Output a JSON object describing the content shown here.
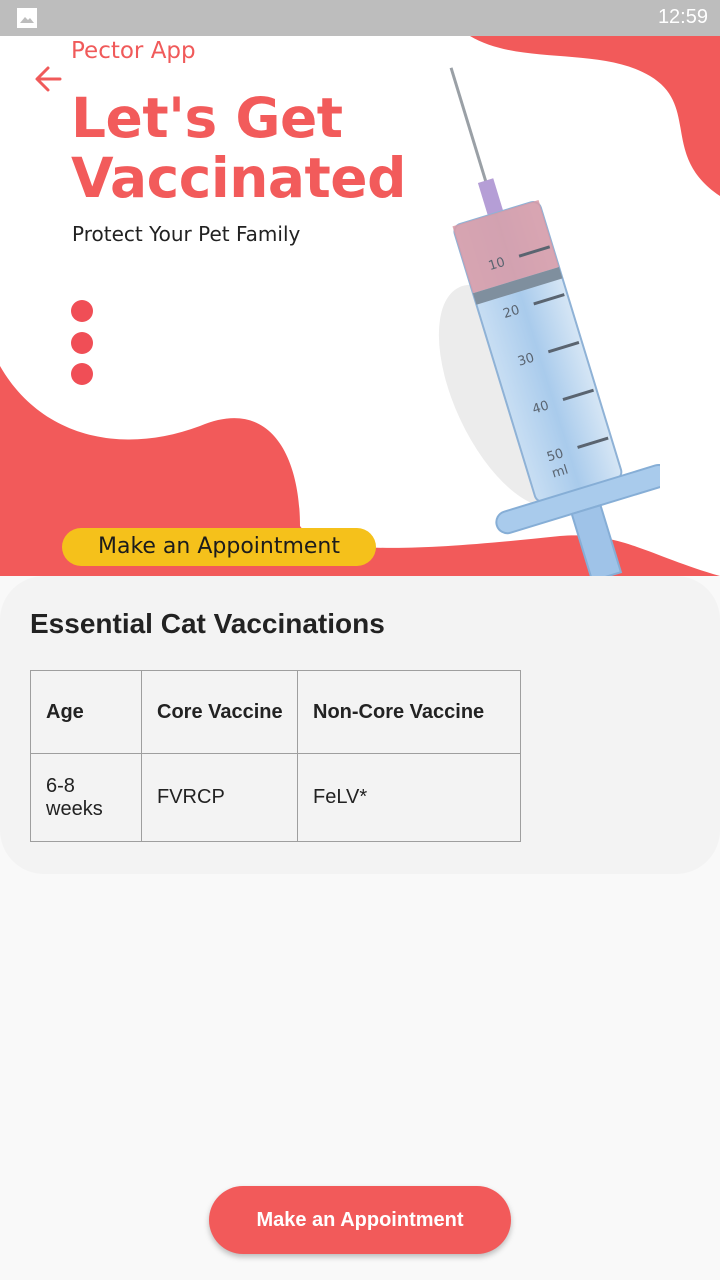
{
  "status_bar": {
    "time": "12:59"
  },
  "hero": {
    "brand": "Pector App",
    "headline_line1": "Let's Get",
    "headline_line2": "Vaccinated",
    "tagline": "Protect Your Pet Family",
    "pill_label": "Make an Appointment",
    "syringe_marks": [
      "10",
      "20",
      "30",
      "40",
      "50",
      "ml"
    ]
  },
  "card": {
    "title": "Essential Cat Vaccinations",
    "table": {
      "headers": [
        "Age",
        "Core Vaccine",
        "Non-Core Vaccine"
      ],
      "rows": [
        {
          "age_line1": "6-8",
          "age_line2": "weeks",
          "core": "FVRCP",
          "noncore": "FeLV*"
        }
      ]
    }
  },
  "cta": {
    "label": "Make an Appointment"
  },
  "colors": {
    "accent": "#f25a5a",
    "pill": "#f5c11b",
    "card_bg": "#f3f3f3"
  }
}
